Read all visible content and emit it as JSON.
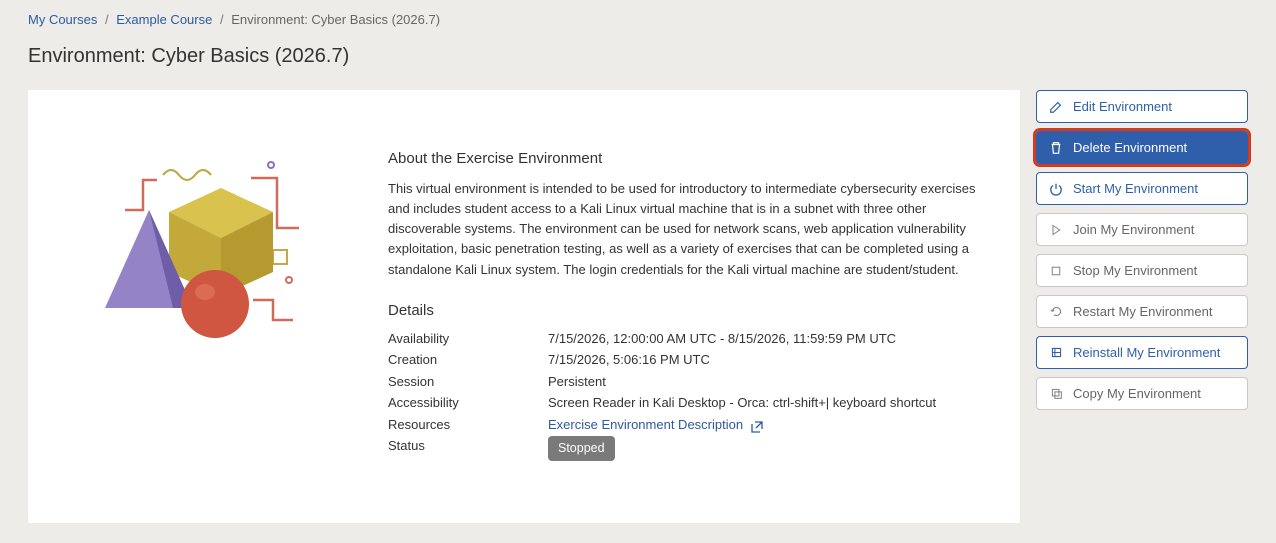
{
  "breadcrumbs": {
    "item1": "My Courses",
    "item2": "Example Course",
    "current": "Environment: Cyber Basics (2026.7)"
  },
  "page_title": "Environment: Cyber Basics (2026.7)",
  "about": {
    "heading": "About the Exercise Environment",
    "description": "This virtual environment is intended to be used for introductory to intermediate cybersecurity exercises and includes student access to a Kali Linux virtual machine that is in a subnet with three other discoverable systems. The environment can be used for network scans, web application vulnerability exploitation, basic penetration testing, as well as a variety of exercises that can be completed using a standalone Kali Linux system. The login credentials for the Kali virtual machine are student/student."
  },
  "details": {
    "heading": "Details",
    "rows": {
      "availability": {
        "label": "Availability",
        "value": "7/15/2026, 12:00:00 AM UTC - 8/15/2026, 11:59:59 PM UTC"
      },
      "creation": {
        "label": "Creation",
        "value": "7/15/2026, 5:06:16 PM UTC"
      },
      "session": {
        "label": "Session",
        "value": "Persistent"
      },
      "accessibility": {
        "label": "Accessibility",
        "value": "Screen Reader in Kali Desktop - Orca: ctrl-shift+| keyboard shortcut"
      },
      "resources": {
        "label": "Resources",
        "link_text": "Exercise Environment Description"
      },
      "status": {
        "label": "Status",
        "badge": "Stopped"
      }
    }
  },
  "actions": {
    "edit": "Edit Environment",
    "delete": "Delete Environment",
    "start": "Start My Environment",
    "join": "Join My Environment",
    "stop": "Stop My Environment",
    "restart": "Restart My Environment",
    "reinstall": "Reinstall My Environment",
    "copy": "Copy My Environment"
  }
}
